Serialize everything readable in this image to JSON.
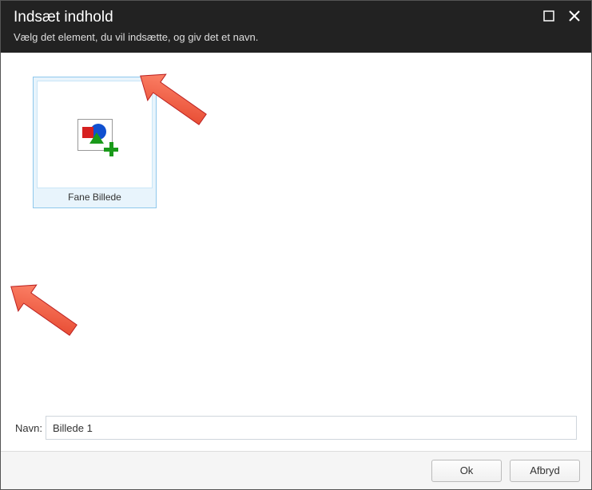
{
  "dialog": {
    "title": "Indsæt indhold",
    "subtitle": "Vælg det element, du vil indsætte, og giv det et navn."
  },
  "tiles": [
    {
      "label": "Fane Billede"
    }
  ],
  "form": {
    "name_label": "Navn:",
    "name_value": "Billede 1"
  },
  "buttons": {
    "ok": "Ok",
    "cancel": "Afbryd"
  }
}
